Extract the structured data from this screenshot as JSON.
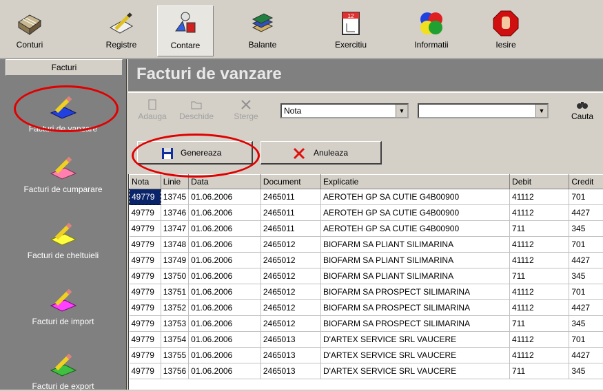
{
  "toolbar": {
    "items": [
      {
        "label": "Conturi",
        "icon": "card-index-icon"
      },
      {
        "label": "Registre",
        "icon": "pencil-paper-icon"
      },
      {
        "label": "Contare",
        "icon": "shapes-icon",
        "active": true
      },
      {
        "label": "Balante",
        "icon": "books-icon"
      },
      {
        "label": "Exercitiu",
        "icon": "calendar-icon"
      },
      {
        "label": "Informatii",
        "icon": "color-circles-icon"
      },
      {
        "label": "Iesire",
        "icon": "stop-hand-icon"
      }
    ]
  },
  "sidebar": {
    "header": "Facturi",
    "items": [
      {
        "label": "Facturi de vanzare",
        "color": "#2040e0"
      },
      {
        "label": "Facturi de cumparare",
        "color": "#ff80b0"
      },
      {
        "label": "Facturi de cheltuieli",
        "color": "#ffff40"
      },
      {
        "label": "Facturi de import",
        "color": "#ff40ff"
      },
      {
        "label": "Facturi de export",
        "color": "#40c040"
      }
    ]
  },
  "main": {
    "title": "Facturi de vanzare",
    "nav": {
      "add": "Adauga",
      "open": "Deschide",
      "delete": "Sterge",
      "search": "Cauta",
      "combo1_value": "Nota",
      "combo2_value": ""
    },
    "actions": {
      "generate": "Genereaza",
      "cancel": "Anuleaza"
    }
  },
  "table": {
    "columns": [
      "Nota",
      "Linie",
      "Data",
      "Document",
      "Explicatie",
      "Debit",
      "Credit"
    ],
    "rows": [
      [
        "49779",
        "13745",
        "01.06.2006",
        "2465011",
        "AEROTEH GP SA CUTIE G4B00900",
        "41112",
        "701"
      ],
      [
        "49779",
        "13746",
        "01.06.2006",
        "2465011",
        "AEROTEH GP SA CUTIE G4B00900",
        "41112",
        "4427"
      ],
      [
        "49779",
        "13747",
        "01.06.2006",
        "2465011",
        "AEROTEH GP SA CUTIE G4B00900",
        "711",
        "345"
      ],
      [
        "49779",
        "13748",
        "01.06.2006",
        "2465012",
        "BIOFARM SA PLIANT SILIMARINA",
        "41112",
        "701"
      ],
      [
        "49779",
        "13749",
        "01.06.2006",
        "2465012",
        "BIOFARM SA PLIANT SILIMARINA",
        "41112",
        "4427"
      ],
      [
        "49779",
        "13750",
        "01.06.2006",
        "2465012",
        "BIOFARM SA PLIANT SILIMARINA",
        "711",
        "345"
      ],
      [
        "49779",
        "13751",
        "01.06.2006",
        "2465012",
        "BIOFARM SA PROSPECT SILIMARINA",
        "41112",
        "701"
      ],
      [
        "49779",
        "13752",
        "01.06.2006",
        "2465012",
        "BIOFARM SA PROSPECT SILIMARINA",
        "41112",
        "4427"
      ],
      [
        "49779",
        "13753",
        "01.06.2006",
        "2465012",
        "BIOFARM SA PROSPECT SILIMARINA",
        "711",
        "345"
      ],
      [
        "49779",
        "13754",
        "01.06.2006",
        "2465013",
        "D'ARTEX SERVICE SRL VAUCERE",
        "41112",
        "701"
      ],
      [
        "49779",
        "13755",
        "01.06.2006",
        "2465013",
        "D'ARTEX SERVICE SRL VAUCERE",
        "41112",
        "4427"
      ],
      [
        "49779",
        "13756",
        "01.06.2006",
        "2465013",
        "D'ARTEX SERVICE SRL VAUCERE",
        "711",
        "345"
      ]
    ]
  },
  "colors": {
    "annotation": "#e00000",
    "selection": "#0a246a",
    "panel": "#808080"
  }
}
